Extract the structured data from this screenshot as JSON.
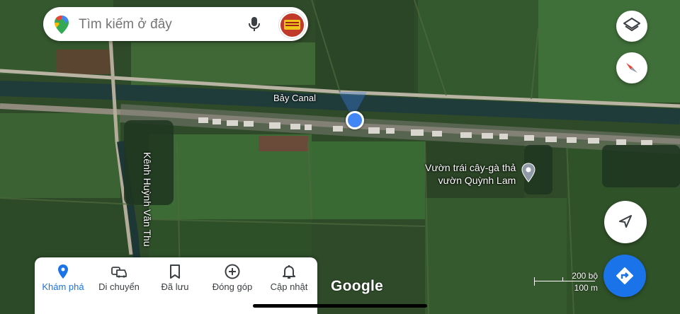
{
  "search": {
    "placeholder": "Tìm kiếm ở đây"
  },
  "map_labels": {
    "canal": "Bảy Canal",
    "poi_line1": "Vườn trái cây-gà thả",
    "poi_line2": "vườn Quỳnh Lam",
    "road": "Kênh Huỳnh Văn Thu"
  },
  "watermark": "Google",
  "scale": {
    "imperial": "200 bộ",
    "metric": "100 m"
  },
  "bottom_nav": [
    {
      "label": "Khám phá",
      "icon": "explore-pin-icon",
      "active": true
    },
    {
      "label": "Di chuyển",
      "icon": "commute-icon",
      "active": false
    },
    {
      "label": "Đã lưu",
      "icon": "bookmark-icon",
      "active": false
    },
    {
      "label": "Đóng góp",
      "icon": "add-circle-icon",
      "active": false
    },
    {
      "label": "Cập nhật",
      "icon": "bell-icon",
      "active": false
    }
  ],
  "colors": {
    "accent": "#1a73e8",
    "location_dot": "#4285f4"
  }
}
